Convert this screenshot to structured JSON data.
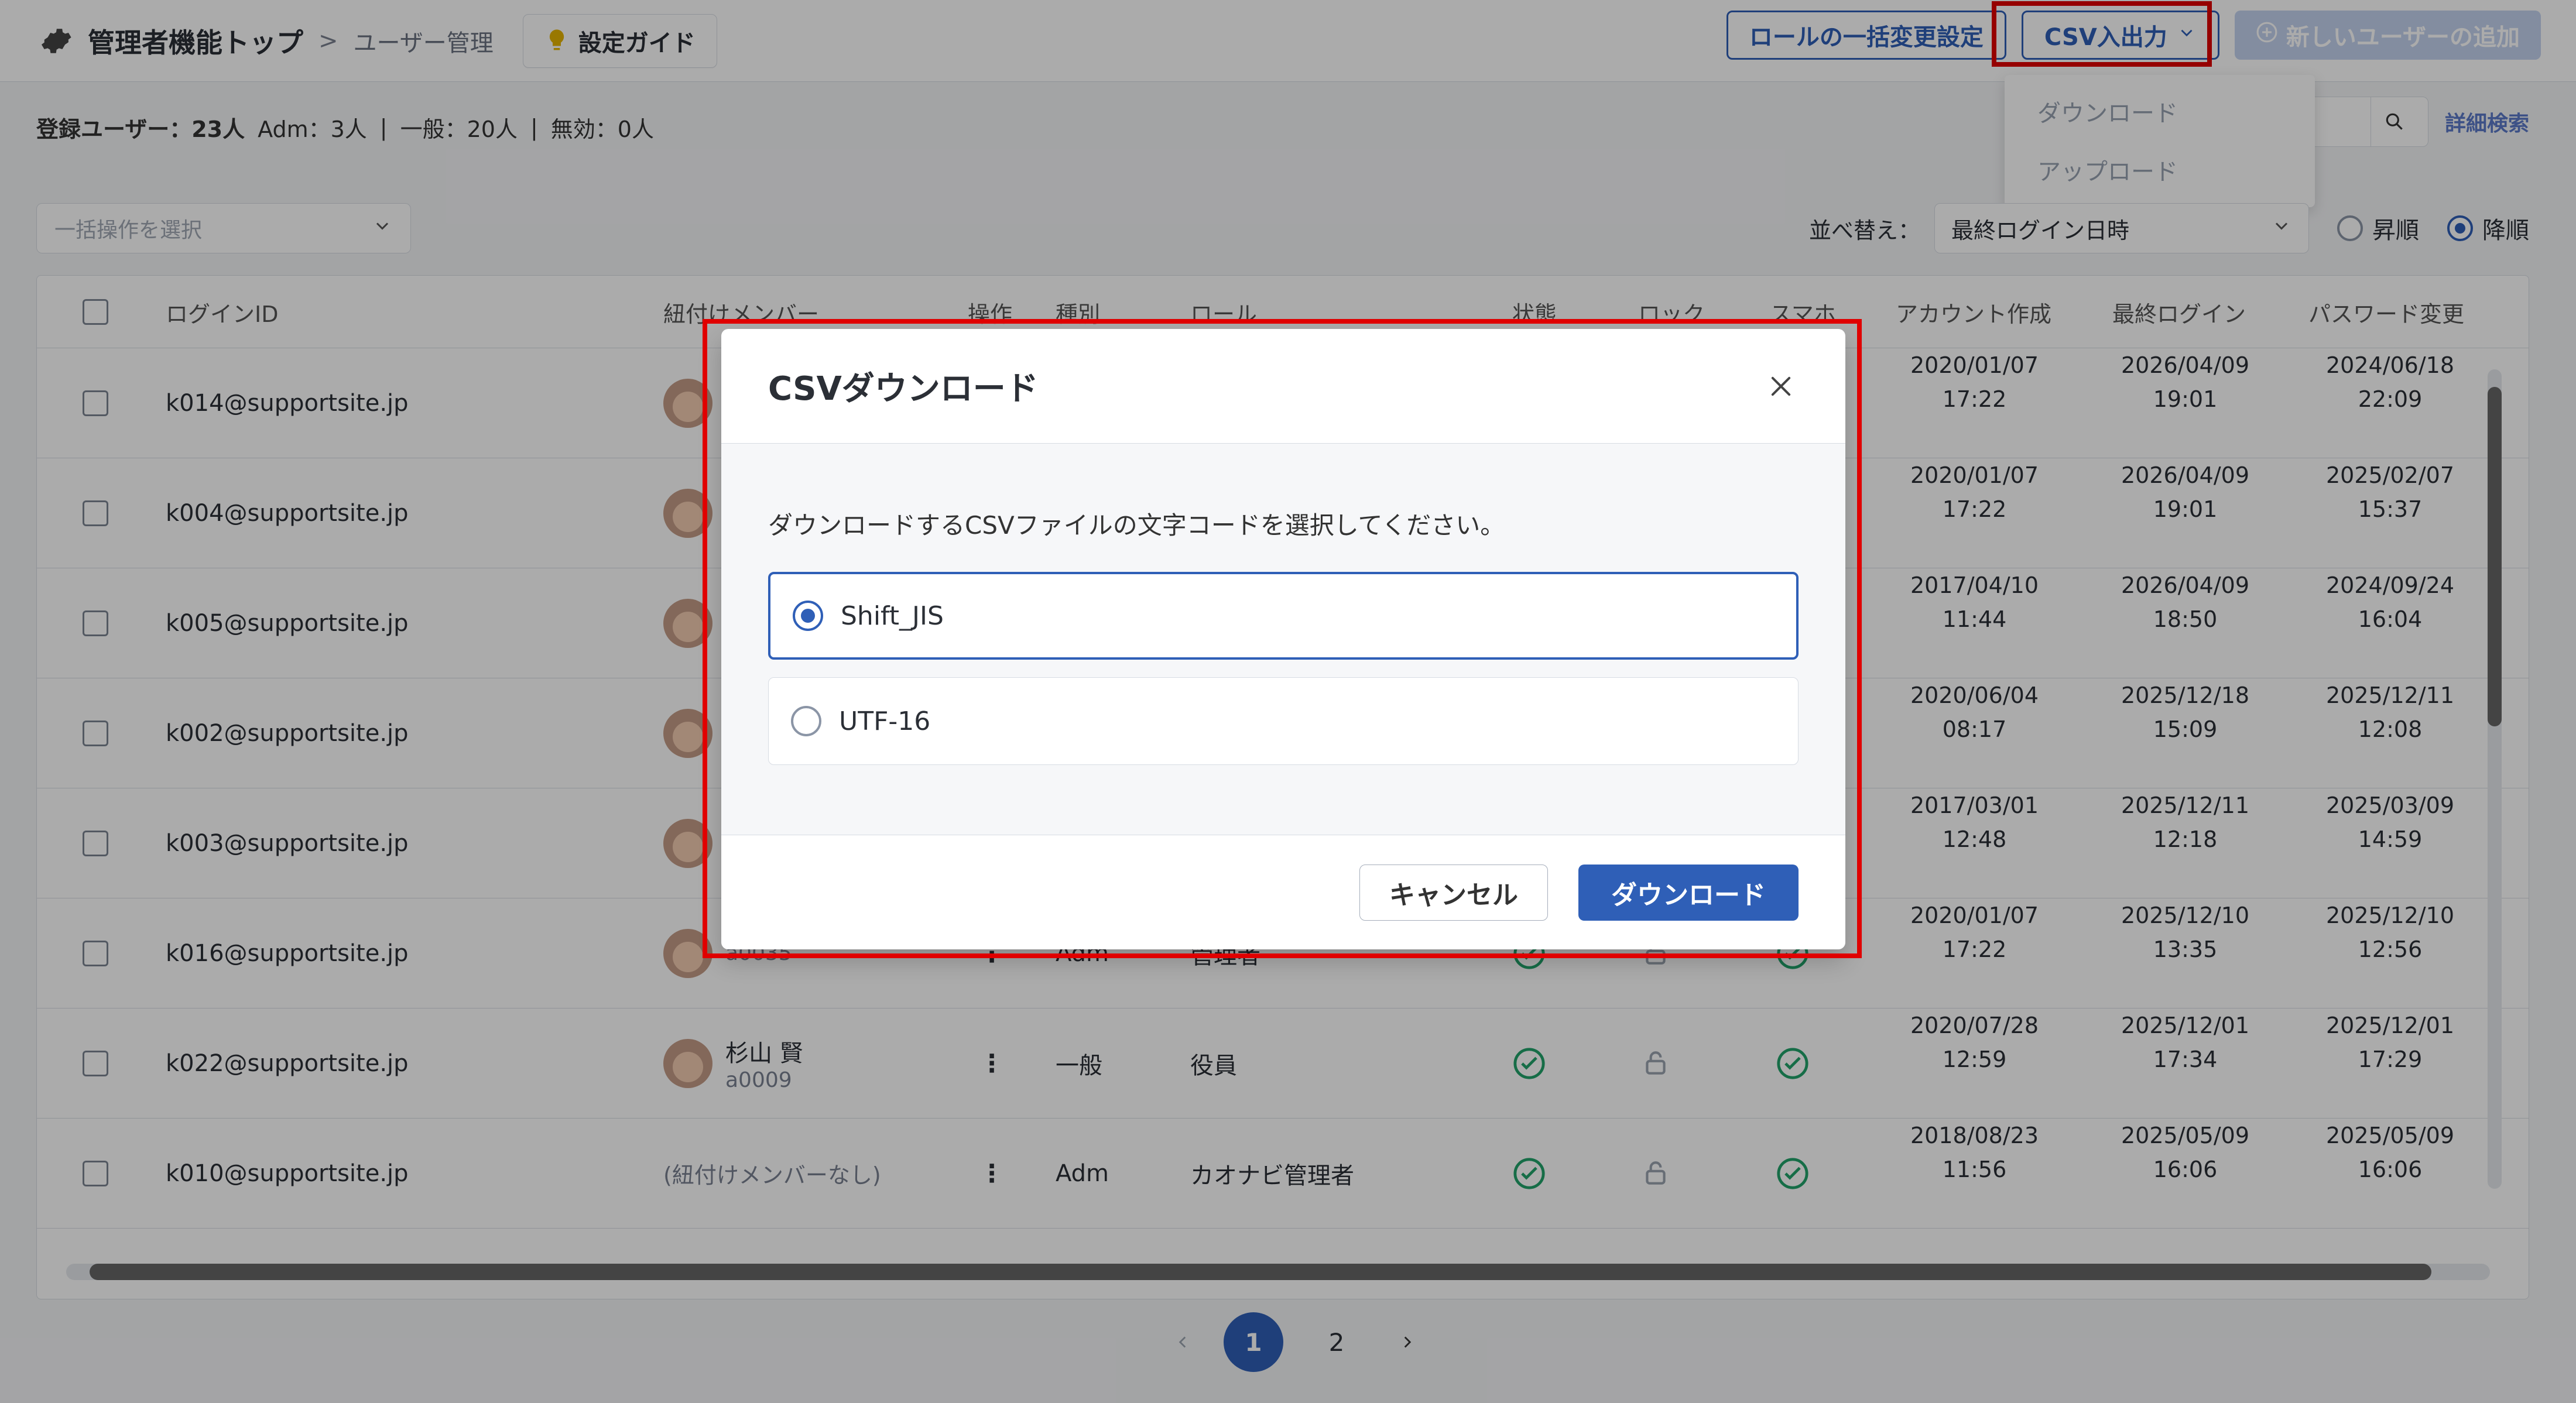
{
  "header": {
    "title": "管理者機能トップ",
    "breadcrumb_separator": ">",
    "breadcrumb_current": "ユーザー管理",
    "guide_label": "設定ガイド",
    "buttons": {
      "role_bulk": "ロールの一括変更設定",
      "csv_io": "CSV入出力",
      "add_user": "新しいユーザーの追加"
    }
  },
  "csv_menu": {
    "items": [
      "ダウンロード",
      "アップロード"
    ]
  },
  "summary": {
    "registered": "登録ユーザー：23人",
    "adm": "Adm：3人",
    "general": "一般：20人",
    "invalid": "無効：0人"
  },
  "search": {
    "advanced": "詳細検索"
  },
  "filters": {
    "bulk_placeholder": "一括操作を選択",
    "sort_label": "並べ替え：",
    "sort_value": "最終ログイン日時",
    "asc_label": "昇順",
    "desc_label": "降順",
    "selected": "desc"
  },
  "table": {
    "headers": {
      "login_id": "ログインID",
      "member": "紐付けメンバー",
      "ops": "操作",
      "type": "種別",
      "role": "ロール",
      "status": "状態",
      "lock": "ロック",
      "phone": "スマホ",
      "created": "アカウント作成",
      "last_login": "最終ログイン",
      "pwd_changed": "パスワード変更"
    },
    "rows": [
      {
        "login": "k014@supportsite.jp",
        "member_name": "",
        "member_id": "",
        "type": "",
        "role": "",
        "created": [
          "2020/01/07",
          "17:22"
        ],
        "last_login": [
          "2026/04/09",
          "19:01"
        ],
        "pwd_changed": [
          "2024/06/18",
          "22:09"
        ]
      },
      {
        "login": "k004@supportsite.jp",
        "member_name": "",
        "member_id": "",
        "type": "",
        "role": "",
        "created": [
          "2020/01/07",
          "17:22"
        ],
        "last_login": [
          "2026/04/09",
          "19:01"
        ],
        "pwd_changed": [
          "2025/02/07",
          "15:37"
        ]
      },
      {
        "login": "k005@supportsite.jp",
        "member_name": "",
        "member_id": "",
        "type": "",
        "role": "",
        "created": [
          "2017/04/10",
          "11:44"
        ],
        "last_login": [
          "2026/04/09",
          "18:50"
        ],
        "pwd_changed": [
          "2024/09/24",
          "16:04"
        ]
      },
      {
        "login": "k002@supportsite.jp",
        "member_name": "",
        "member_id": "",
        "type": "",
        "role": "",
        "created": [
          "2020/06/04",
          "08:17"
        ],
        "last_login": [
          "2025/12/18",
          "15:09"
        ],
        "pwd_changed": [
          "2025/12/11",
          "12:08"
        ]
      },
      {
        "login": "k003@supportsite.jp",
        "member_name": "",
        "member_id": "",
        "type": "",
        "role": "",
        "created": [
          "2017/03/01",
          "12:48"
        ],
        "last_login": [
          "2025/12/11",
          "12:18"
        ],
        "pwd_changed": [
          "2025/03/09",
          "14:59"
        ]
      },
      {
        "login": "k016@supportsite.jp",
        "member_name": "",
        "member_id": "a0035",
        "type": "Adm",
        "role": "管理者",
        "created": [
          "2020/01/07",
          "17:22"
        ],
        "last_login": [
          "2025/12/10",
          "13:35"
        ],
        "pwd_changed": [
          "2025/12/10",
          "12:56"
        ]
      },
      {
        "login": "k022@supportsite.jp",
        "member_name": "杉山 賢",
        "member_id": "a0009",
        "type": "一般",
        "role": "役員",
        "created": [
          "2020/07/28",
          "12:59"
        ],
        "last_login": [
          "2025/12/01",
          "17:34"
        ],
        "pwd_changed": [
          "2025/12/01",
          "17:29"
        ]
      },
      {
        "login": "k010@supportsite.jp",
        "member_name": "(紐付けメンバーなし)",
        "member_id": "",
        "type": "Adm",
        "role": "カオナビ管理者",
        "created": [
          "2018/08/23",
          "11:56"
        ],
        "last_login": [
          "2025/05/09",
          "16:06"
        ],
        "pwd_changed": [
          "2025/05/09",
          "16:06"
        ]
      }
    ]
  },
  "pagination": {
    "pages": [
      "1",
      "2"
    ],
    "current": "1"
  },
  "modal": {
    "title": "CSVダウンロード",
    "description": "ダウンロードするCSVファイルの文字コードを選択してください。",
    "options": [
      "Shift_JIS",
      "UTF-16"
    ],
    "selected_option": "Shift_JIS",
    "cancel_label": "キャンセル",
    "download_label": "ダウンロード"
  },
  "colors": {
    "primary": "#2f5fb7",
    "highlight_frame": "#e00000",
    "check_green": "#21a36a"
  },
  "icons": [
    "gear-icon",
    "lightbulb-icon",
    "chevron-down-icon",
    "search-icon",
    "check-circle-icon",
    "lock-icon",
    "kebab-icon",
    "close-icon",
    "chevron-left-icon",
    "chevron-right-icon"
  ]
}
